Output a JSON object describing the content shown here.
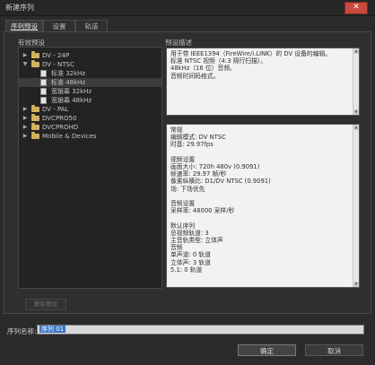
{
  "window": {
    "title": "新建序列",
    "close_glyph": "✕"
  },
  "tabs": [
    {
      "label": "序列预设",
      "active": true
    },
    {
      "label": "设置",
      "active": false
    },
    {
      "label": "轨道",
      "active": false
    }
  ],
  "available_presets": {
    "label": "有效预设",
    "tree": [
      {
        "label": "DV - 24P",
        "kind": "folder",
        "expanded": false,
        "indent": 0
      },
      {
        "label": "DV - NTSC",
        "kind": "folder",
        "expanded": true,
        "indent": 0
      },
      {
        "label": "标准 32kHz",
        "kind": "file",
        "indent": 1
      },
      {
        "label": "标准 48kHz",
        "kind": "file",
        "indent": 1,
        "selected": true
      },
      {
        "label": "宽银幕 32kHz",
        "kind": "file",
        "indent": 1
      },
      {
        "label": "宽银幕 48kHz",
        "kind": "file",
        "indent": 1
      },
      {
        "label": "DV - PAL",
        "kind": "folder",
        "expanded": false,
        "indent": 0
      },
      {
        "label": "DVCPRO50",
        "kind": "folder",
        "expanded": false,
        "indent": 0
      },
      {
        "label": "DVCPROHD",
        "kind": "folder",
        "expanded": false,
        "indent": 0
      },
      {
        "label": "Mobile & Devices",
        "kind": "folder",
        "expanded": false,
        "indent": 0
      }
    ],
    "delete_button": "删除预设"
  },
  "preset_description": {
    "label": "预设描述",
    "lines": [
      "用于带 IEEE1394（FireWire/i.LINK）的 DV 设备的编辑。",
      "标准 NTSC 视频（4:3 隔行扫描）。",
      "48kHz（16 位）音频。",
      "音频时间码格式。"
    ]
  },
  "general_info": {
    "lines": [
      "常规",
      "  编辑模式: DV NTSC",
      "  时基: 29.97fps",
      "",
      "视频设置",
      "  画面大小: 720h 480v (0.9091)",
      "  帧速率: 29.97 帧/秒",
      "  像素纵横比: D1/DV NTSC (0.9091)",
      "  场: 下场优先",
      "",
      "音频设置",
      "  采样率: 48000 采样/秒",
      "",
      "默认序列",
      "  总视频轨道: 3",
      "  主音轨类型: 立体声",
      "  音频",
      "  单声道: 0 轨道",
      "  立体声: 3 轨道",
      "  5.1: 0 轨道"
    ]
  },
  "sequence_name": {
    "label": "序列名称:",
    "value": "序列 01"
  },
  "buttons": {
    "ok": "确定",
    "cancel": "取消"
  }
}
